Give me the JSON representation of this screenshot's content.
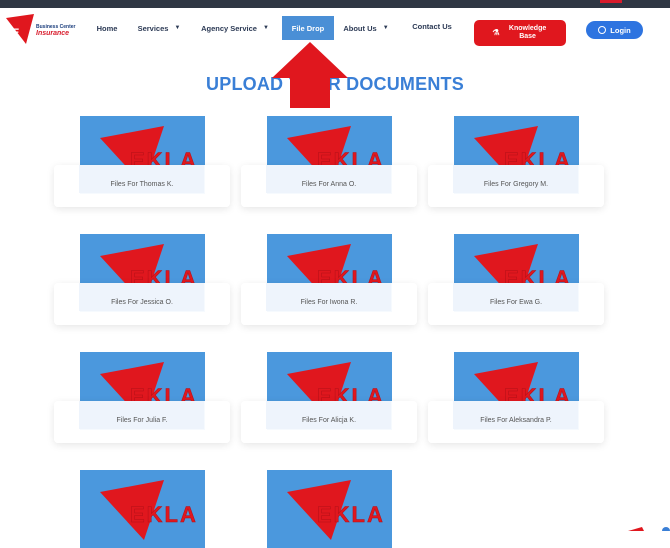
{
  "logo": {
    "line1": "Business Center",
    "line2": "Insurance"
  },
  "nav": {
    "items": [
      {
        "label": "Home",
        "has_dropdown": false
      },
      {
        "label": "Services",
        "has_dropdown": true
      },
      {
        "label": "Agency Service",
        "has_dropdown": true
      },
      {
        "label": "File Drop",
        "has_dropdown": false,
        "active": true
      },
      {
        "label": "About Us",
        "has_dropdown": true
      },
      {
        "label": "Contact Us",
        "has_dropdown": false
      }
    ],
    "knowledge_base": "Knowledge Base",
    "login": "Login"
  },
  "page": {
    "title": "UPLOAD YOUR DOCUMENTS"
  },
  "cards": [
    {
      "label": "Files For Thomas K."
    },
    {
      "label": "Files For Anna O."
    },
    {
      "label": "Files For Gregory M."
    },
    {
      "label": "Files For Jessica O."
    },
    {
      "label": "Files For Iwona R."
    },
    {
      "label": "Files For Ewa G."
    },
    {
      "label": "Files For Julia F."
    },
    {
      "label": "Files For Alicja K."
    },
    {
      "label": "Files For Aleksandra P."
    },
    {
      "label": ""
    },
    {
      "label": ""
    }
  ],
  "colors": {
    "accent": "#3a7fd6",
    "brand_red": "#e0171e",
    "card_blue": "#4b98dd",
    "nav_active": "#4a8fd6"
  },
  "icons": {
    "dropdown": "chevron-down-icon",
    "knowledge": "flask-icon",
    "login": "user-circle-icon",
    "annotation": "red-arrow-up-icon"
  }
}
